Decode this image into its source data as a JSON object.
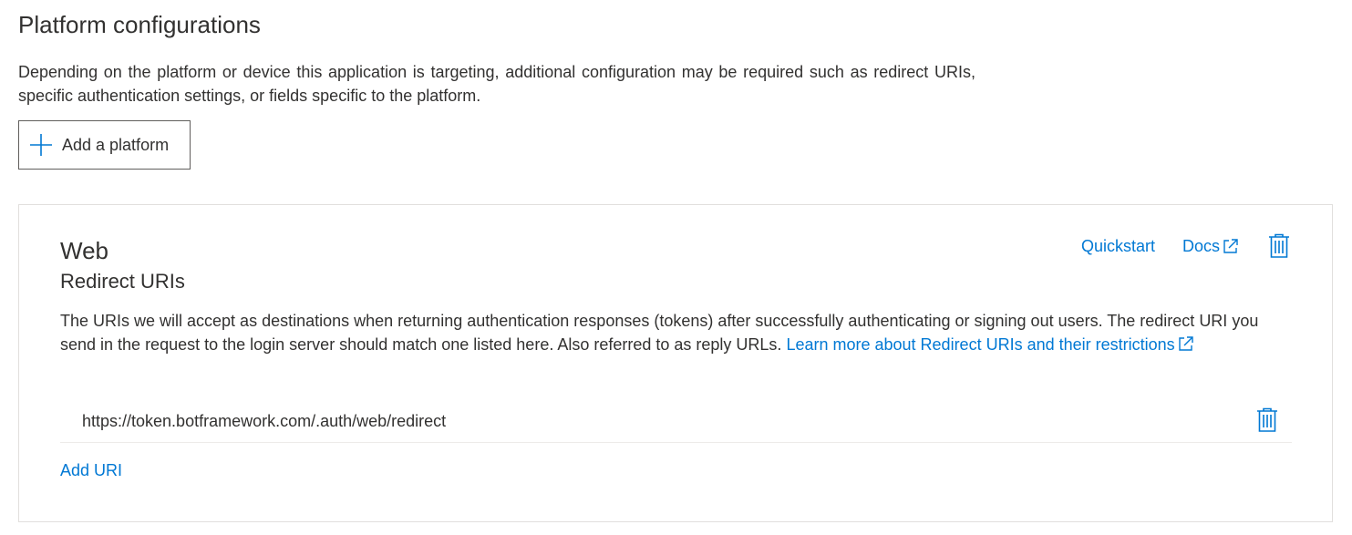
{
  "page": {
    "title": "Platform configurations",
    "intro": "Depending on the platform or device this application is targeting, additional configuration may be required such as redirect URIs, specific authentication settings, or fields specific to the platform.",
    "add_platform_label": "Add a platform"
  },
  "card": {
    "title": "Web",
    "quickstart_label": "Quickstart",
    "docs_label": "Docs",
    "section_title": "Redirect URIs",
    "description": "The URIs we will accept as destinations when returning authentication responses (tokens) after successfully authenticating or signing out users. The redirect URI you send in the request to the login server should match one listed here. Also referred to as reply URLs.",
    "learn_more_label": "Learn more about Redirect URIs and their restrictions",
    "redirect_uris": [
      "https://token.botframework.com/.auth/web/redirect"
    ],
    "add_uri_label": "Add URI"
  },
  "colors": {
    "accent": "#0078d4",
    "text": "#323130",
    "border": "#e1dfdd"
  },
  "icons": {
    "add": "plus-icon",
    "external": "external-link-icon",
    "delete": "trash-icon"
  }
}
